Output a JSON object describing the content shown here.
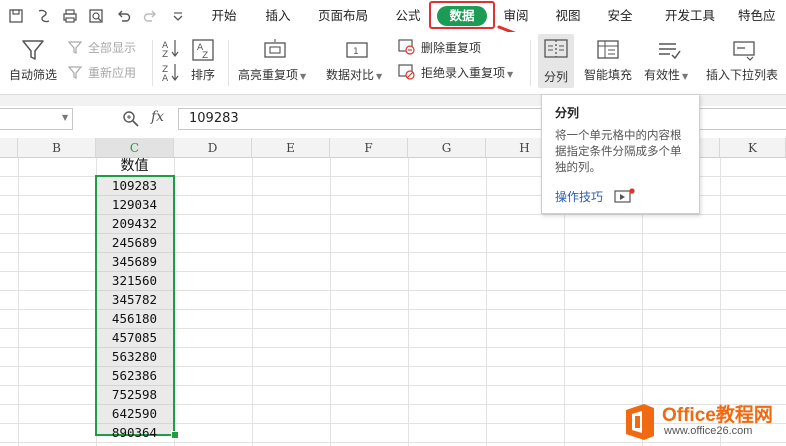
{
  "quick_access": {
    "icons": [
      "save-icon",
      "print-preview-icon",
      "print-icon",
      "zoom-preview-icon",
      "undo-icon",
      "redo-icon",
      "customize-dropdown-icon"
    ]
  },
  "menu": {
    "tabs": [
      "开始",
      "插入",
      "页面布局",
      "公式",
      "数据",
      "审阅",
      "视图",
      "安全",
      "开发工具",
      "特色应"
    ],
    "active": "数据",
    "active_color": "#1c9b54",
    "highlight_color": "#e23030"
  },
  "ribbon": {
    "auto_filter": "自动筛选",
    "show_all": "全部显示",
    "reapply": "重新应用",
    "sort": "排序",
    "highlight_dup": "高亮重复项",
    "compare": "数据对比",
    "remove_dup": "删除重复项",
    "reject_dup": "拒绝录入重复项",
    "split": "分列",
    "smart_fill": "智能填充",
    "validity": "有效性",
    "dropdown_list": "插入下拉列表"
  },
  "formula_bar": {
    "fx": "fx",
    "value": "109283"
  },
  "grid": {
    "columns": [
      "B",
      "C",
      "D",
      "E",
      "F",
      "G",
      "H",
      "K"
    ],
    "header_cell": "数值",
    "values": [
      "109283",
      "129034",
      "209432",
      "245689",
      "345689",
      "321560",
      "345782",
      "456180",
      "457085",
      "563280",
      "562386",
      "752598",
      "642590",
      "890364"
    ],
    "selection_color": "#1f9d45"
  },
  "tooltip": {
    "title": "分列",
    "body": "将一个单元格中的内容根据指定条件分隔成多个单独的列。",
    "link": "操作技巧"
  },
  "watermark": {
    "brand": "Office教程网",
    "url": "www.office26.com",
    "orange": "#f06a12"
  }
}
